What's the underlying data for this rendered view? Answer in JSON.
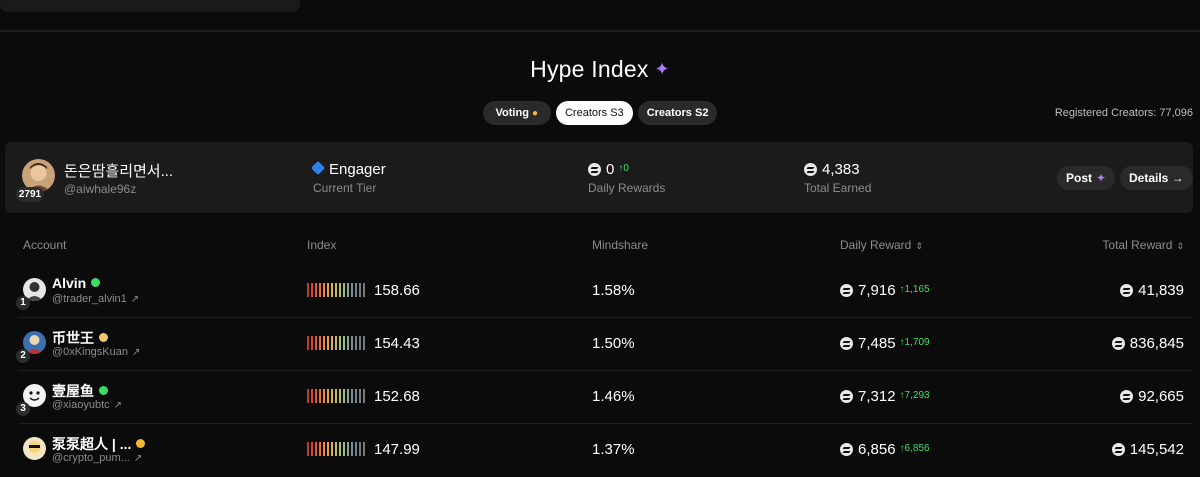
{
  "page": {
    "title": "Hype Index",
    "registered": "Registered Creators: 77,096"
  },
  "tabs": [
    {
      "label": "Voting",
      "active": false
    },
    {
      "label": "Creators S3",
      "active": true
    },
    {
      "label": "Creators S2",
      "active": false
    }
  ],
  "me": {
    "rank": "2791",
    "name": "돈은땀흘리면서...",
    "handle": "@aiwhale96z",
    "tier": "Engager",
    "tier_label": "Current Tier",
    "daily_rewards": "0",
    "daily_delta": "0",
    "daily_label": "Daily Rewards",
    "total_earned": "4,383",
    "total_label": "Total Earned",
    "post_label": "Post",
    "details_label": "Details →"
  },
  "table": {
    "headers": {
      "account": "Account",
      "index": "Index",
      "mindshare": "Mindshare",
      "daily_reward": "Daily Reward",
      "total_reward": "Total Reward"
    },
    "rows": [
      {
        "rank": "1",
        "name": "Alvin",
        "handle": "@trader_alvin1",
        "badge_color": "#3ddc66",
        "index": "158.66",
        "mindshare": "1.58%",
        "daily": "7,916",
        "delta": "1,165",
        "total": "41,839"
      },
      {
        "rank": "2",
        "name": "币世王",
        "handle": "@0xKingsKuan",
        "badge_color": "#f5c56b",
        "index": "154.43",
        "mindshare": "1.50%",
        "daily": "7,485",
        "delta": "1,709",
        "total": "836,845"
      },
      {
        "rank": "3",
        "name": "壹屋鱼",
        "handle": "@xiaoyubtc",
        "badge_color": "#3ddc66",
        "index": "152.68",
        "mindshare": "1.46%",
        "daily": "7,312",
        "delta": "7,293",
        "total": "92,665"
      },
      {
        "rank": "4",
        "name": "泵泵超人 | ...",
        "handle": "@crypto_pum...",
        "badge_color": "#f7b733",
        "index": "147.99",
        "mindshare": "1.37%",
        "daily": "6,856",
        "delta": "6,856",
        "total": "145,542"
      }
    ]
  },
  "colors": {
    "accent_purple": "#a57ef3",
    "up_green": "#3ddc66",
    "tier_blue": "#2f80ed"
  }
}
